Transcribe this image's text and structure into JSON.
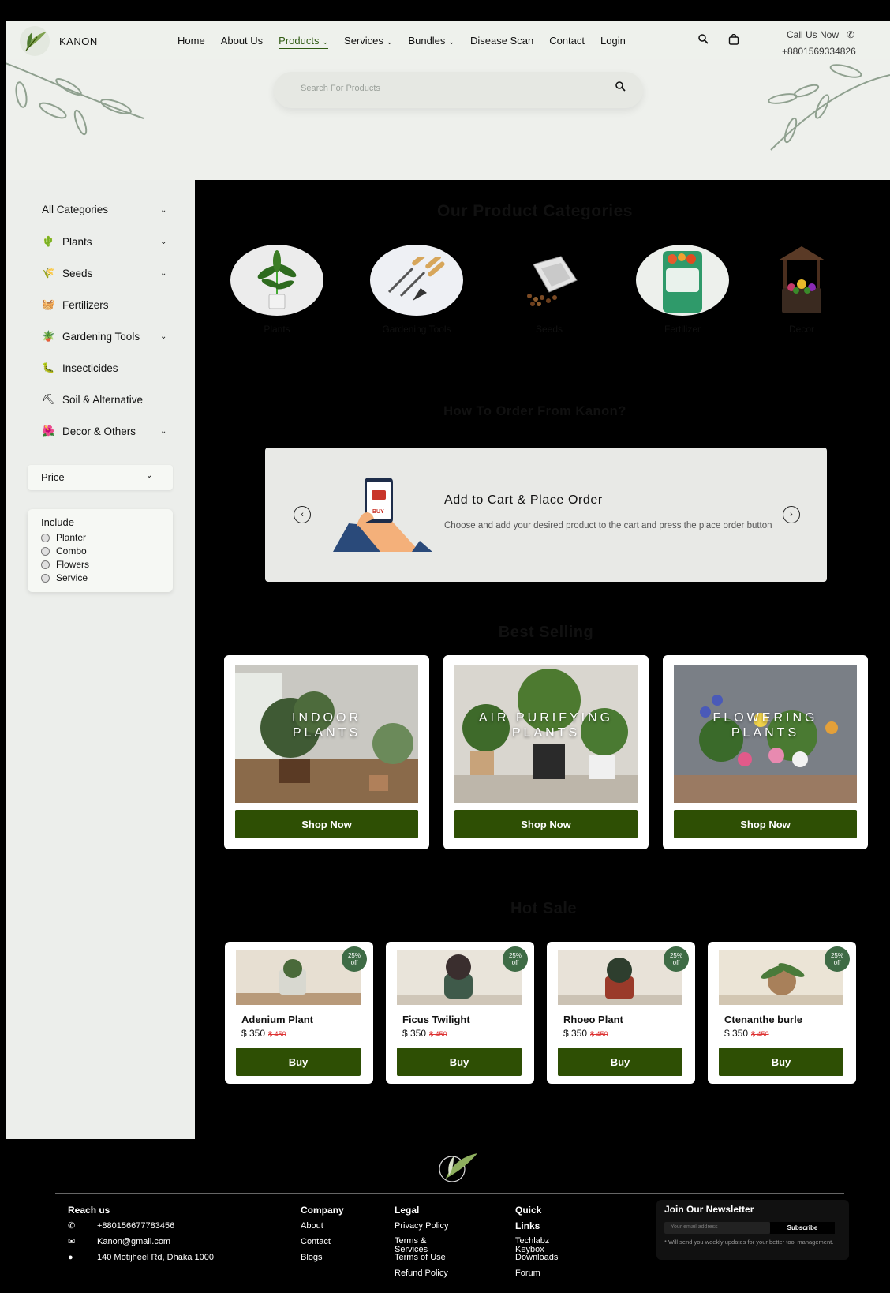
{
  "header": {
    "brand": "KANON",
    "nav": [
      {
        "label": "Home"
      },
      {
        "label": "About Us"
      },
      {
        "label": "Products"
      },
      {
        "label": "Services"
      },
      {
        "label": "Bundles"
      },
      {
        "label": "Disease Scan"
      },
      {
        "label": "Contact"
      },
      {
        "label": "Login"
      }
    ],
    "call_label": "Call Us Now",
    "phone": "+8801569334826"
  },
  "search": {
    "placeholder": "Search For Products"
  },
  "sidebar": {
    "all_categories": "All Categories",
    "categories": [
      {
        "label": "Plants",
        "icon": "plant-icon"
      },
      {
        "label": "Seeds",
        "icon": "seeds-icon"
      },
      {
        "label": "Fertilizers",
        "icon": "fertilizer-icon"
      },
      {
        "label": "Gardening Tools",
        "icon": "tools-icon"
      },
      {
        "label": "Insecticides",
        "icon": "insecticide-icon"
      },
      {
        "label": "Soil & Alternative",
        "icon": "soil-icon"
      },
      {
        "label": "Decor & Others",
        "icon": "decor-icon"
      }
    ],
    "price_label": "Price",
    "include_title": "Include",
    "include_options": [
      "Planter",
      "Combo",
      "Flowers",
      "Service"
    ]
  },
  "categories_section": {
    "title": "Our Product Categories",
    "items": [
      "Plants",
      "Gardening Tools",
      "Seeds",
      "Fertilizer",
      "Decor"
    ]
  },
  "how_to_order": {
    "title": "How To Order From Kanon?",
    "step_title": "Add to Cart & Place Order",
    "step_desc": "Choose and add your desired product to the cart and press the place order button",
    "phone_screen_text": "BUY"
  },
  "best_selling": {
    "title": "Best Selling",
    "cards": [
      {
        "line1": "INDOOR",
        "line2": "PLANTS",
        "button": "Shop Now"
      },
      {
        "line1": "AIR PURIFYING",
        "line2": "PLANTS",
        "button": "Shop Now"
      },
      {
        "line1": "FLOWERING",
        "line2": "PLANTS",
        "button": "Shop Now"
      }
    ]
  },
  "hot_sale": {
    "title": "Hot Sale",
    "items": [
      {
        "name": "Adenium Plant",
        "price": "$ 350",
        "old_price": "$ 450",
        "badge1": "25%",
        "badge2": "off",
        "button": "Buy"
      },
      {
        "name": "Ficus Twilight",
        "price": "$ 350",
        "old_price": "$ 450",
        "badge1": "25%",
        "badge2": "off",
        "button": "Buy"
      },
      {
        "name": "Rhoeo Plant",
        "price": "$ 350",
        "old_price": "$ 450",
        "badge1": "25%",
        "badge2": "off",
        "button": "Buy"
      },
      {
        "name": "Ctenanthe burle",
        "price": "$ 350",
        "old_price": "$ 450",
        "badge1": "25%",
        "badge2": "off",
        "button": "Buy"
      }
    ]
  },
  "footer": {
    "reach_title": "Reach us",
    "phone": "+880156677783456",
    "email": "Kanon@gmail.com",
    "address": "140 Motijheel Rd, Dhaka 1000",
    "company_title": "Company",
    "company_links": [
      "About",
      "Contact",
      "Blogs"
    ],
    "legal_title": "Legal",
    "legal_links": [
      "Privacy Policy",
      "Terms & Services",
      "Terms of Use",
      "Refund Policy"
    ],
    "quick_title": "Quick Links",
    "quick_links": [
      "Techlabz Keybox",
      "Downloads",
      "Forum"
    ],
    "newsletter_title": "Join Our Newsletter",
    "newsletter_placeholder": "Your email address",
    "subscribe": "Subscribe",
    "newsletter_note": "* Will send you weekly updates for your better tool management."
  }
}
